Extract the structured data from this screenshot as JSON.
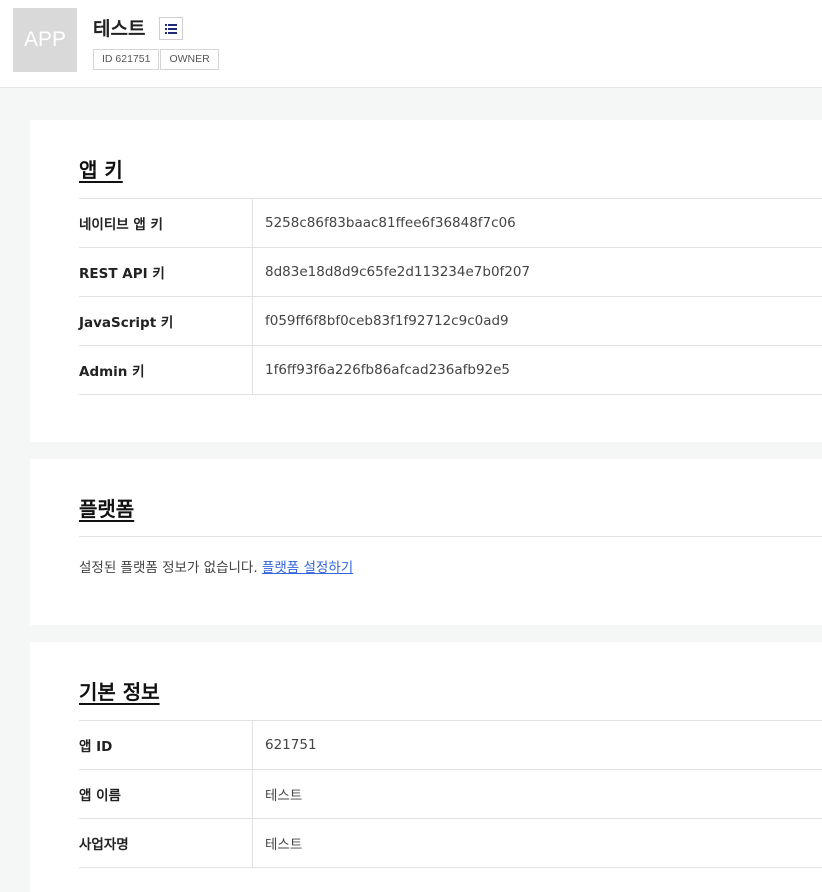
{
  "header": {
    "logo_text": "APP",
    "app_name": "테스트",
    "menu_icon": "list-icon",
    "badges": [
      "ID 621751",
      "OWNER"
    ]
  },
  "app_keys": {
    "title": "앱 키",
    "rows": [
      {
        "label": "네이티브 앱 키",
        "value": "5258c86f83baac81ffee6f36848f7c06"
      },
      {
        "label": "REST API 키",
        "value": "8d83e18d8d9c65fe2d113234e7b0f207"
      },
      {
        "label": "JavaScript 키",
        "value": "f059ff6f8bf0ceb83f1f92712c9c0ad9"
      },
      {
        "label": "Admin 키",
        "value": "1f6ff93f6a226fb86afcad236afb92e5"
      }
    ]
  },
  "platform": {
    "title": "플랫폼",
    "message": "설정된 플랫폼 정보가 없습니다.",
    "link": "플랫폼 설정하기"
  },
  "basic_info": {
    "title": "기본 정보",
    "rows": [
      {
        "label": "앱 ID",
        "value": "621751"
      },
      {
        "label": "앱 이름",
        "value": "테스트"
      },
      {
        "label": "사업자명",
        "value": "테스트"
      }
    ]
  },
  "colors": {
    "link": "#3366dd",
    "menu_icon": "#1e2a78",
    "logo_bg": "#d9d9d9"
  }
}
